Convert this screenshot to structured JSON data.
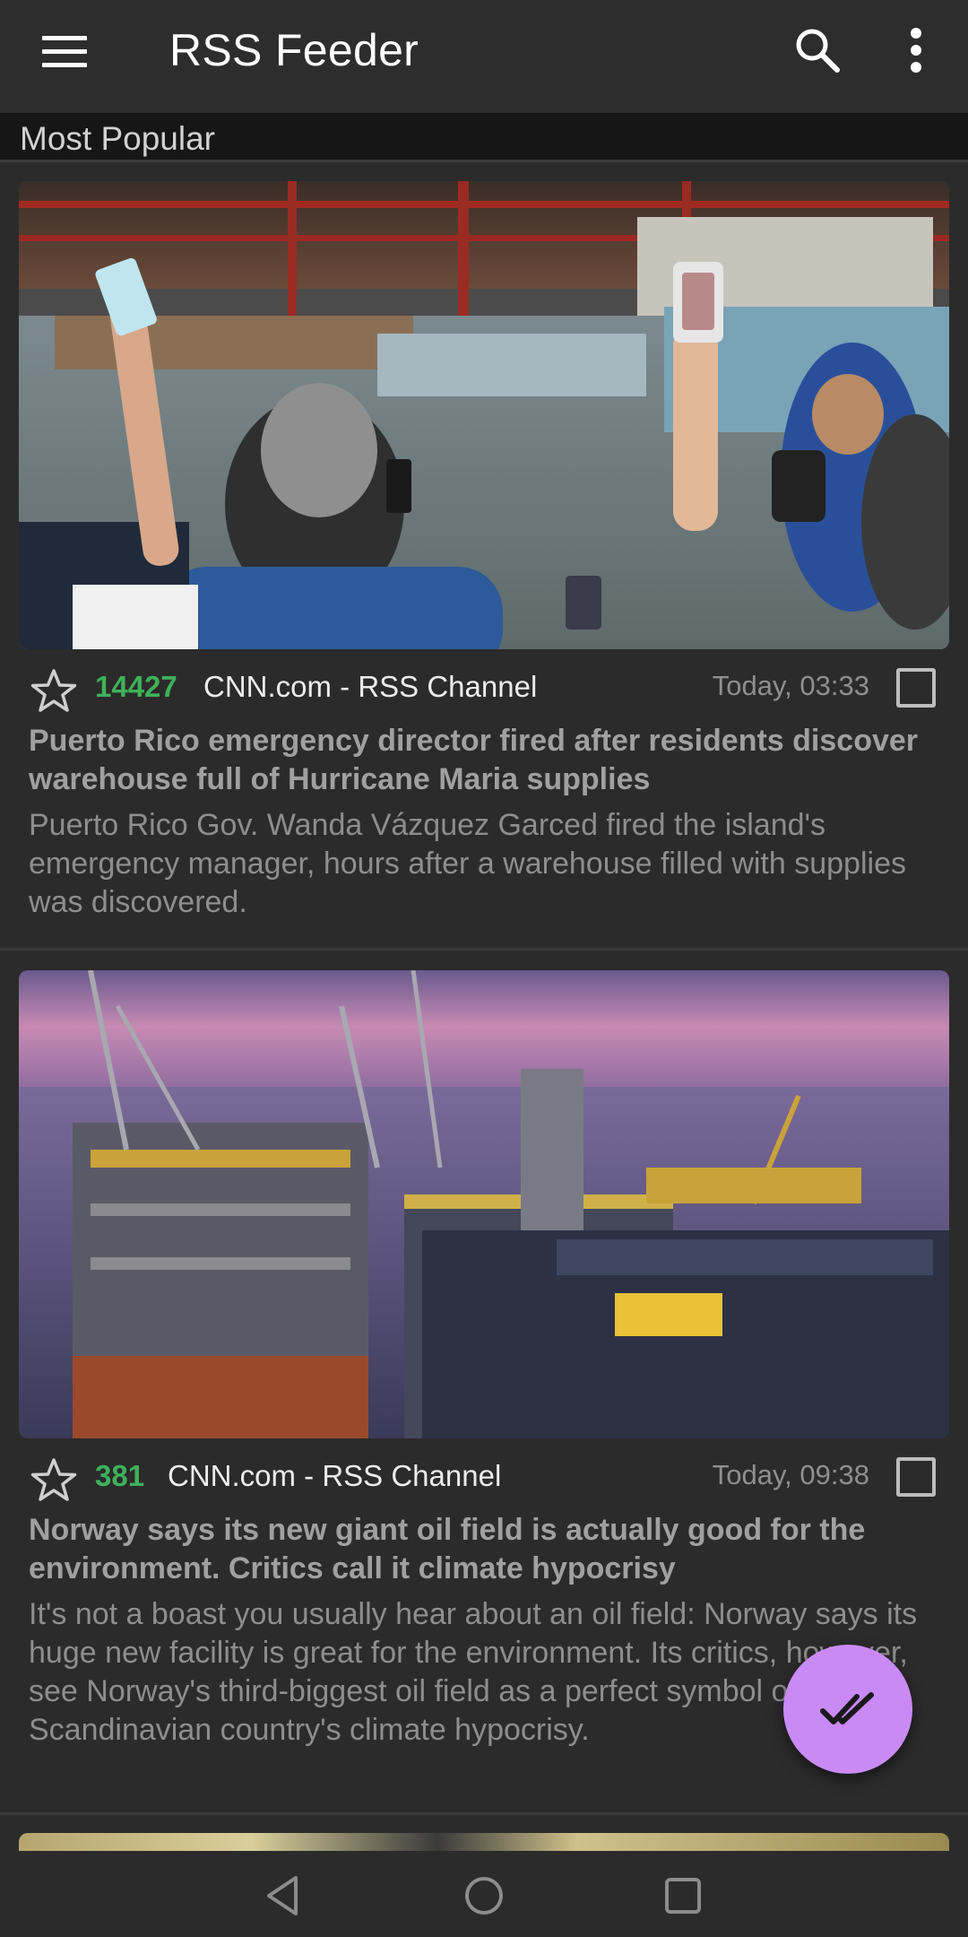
{
  "app_bar": {
    "title": "RSS Feeder",
    "icons": [
      "menu-icon",
      "search-icon",
      "more-vert-icon"
    ]
  },
  "section": {
    "title": "Most Popular"
  },
  "articles": [
    {
      "score": "14427",
      "source": "CNN.com - RSS Channel",
      "time": "Today, 03:33",
      "headline": "Puerto Rico emergency director fired after residents discover warehouse full of Hurricane Maria supplies",
      "summary": "Puerto Rico Gov. Wanda Vázquez Garced fired the island's emergency manager, hours after a warehouse filled with supplies was discovered.",
      "starred": false,
      "checked": false
    },
    {
      "score": "381",
      "source": "CNN.com - RSS Channel",
      "time": "Today, 09:38",
      "headline": "Norway says its new giant oil field is actually good for the environment. Critics call it climate hypocrisy",
      "summary": "It's not a boast you usually hear about an oil field: Norway says its huge new facility is great for the environment. Its critics, however, see Norway's third-biggest oil field as a perfect symbol of the Scandinavian country's climate hypocrisy.",
      "starred": false,
      "checked": false
    }
  ],
  "colors": {
    "background": "#2b2b2b",
    "score_green": "#3fb15a",
    "fab": "#c98af5"
  },
  "fab": {
    "icon": "done-all-icon"
  },
  "navigation": {
    "icons": [
      "back-icon",
      "home-icon",
      "recents-icon"
    ]
  }
}
